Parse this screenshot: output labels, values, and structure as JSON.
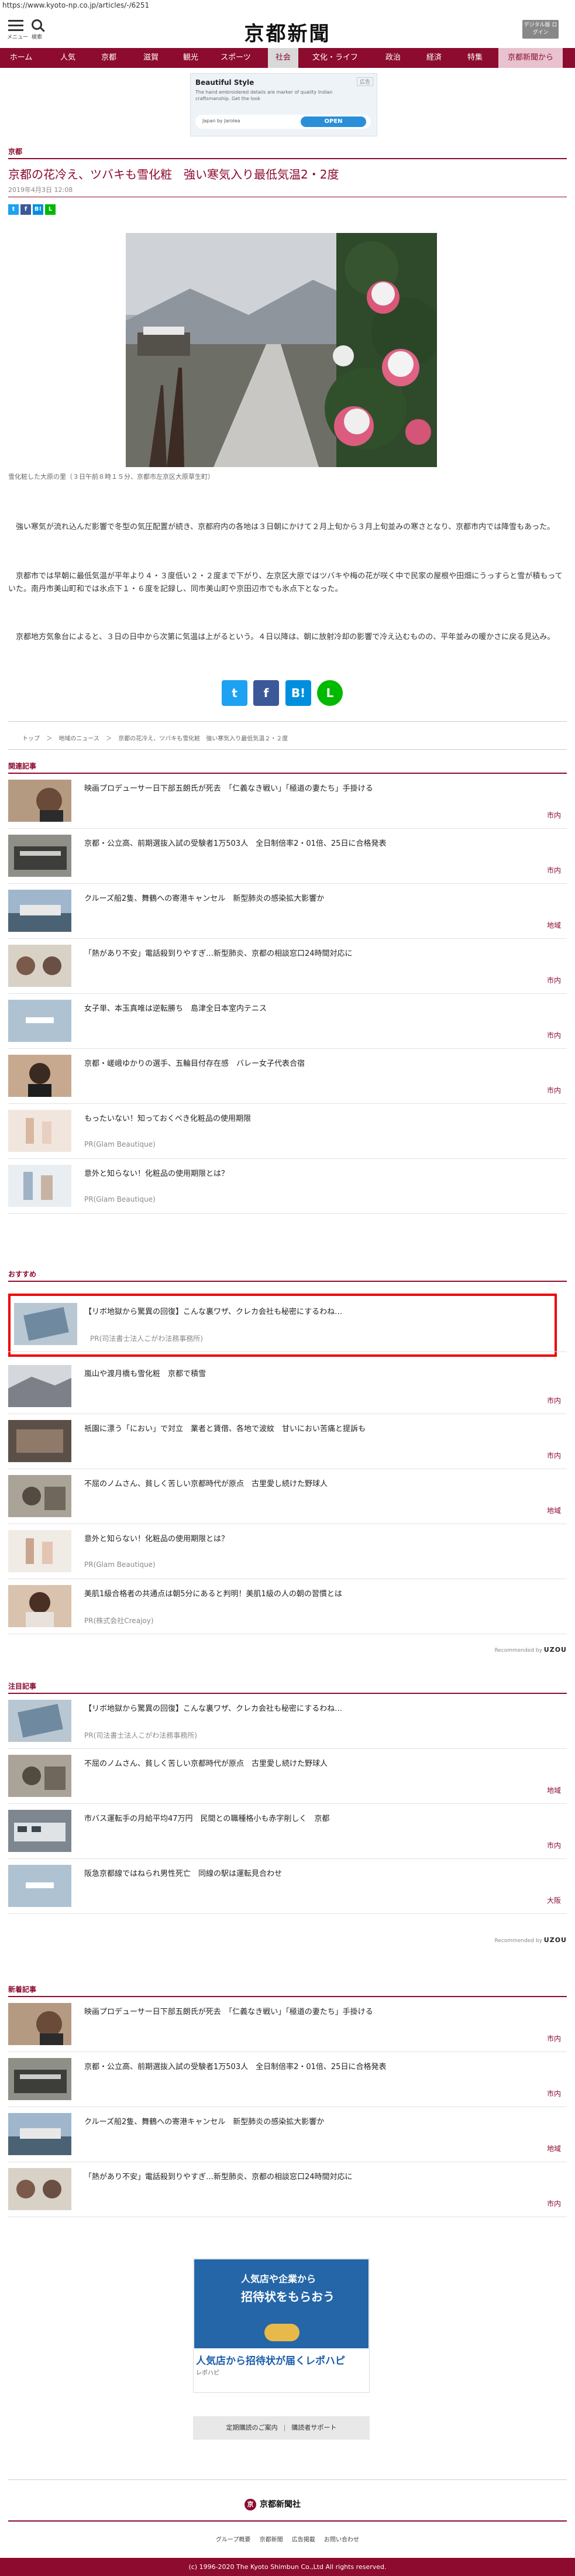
{
  "browser": {
    "url": "https://www.kyoto-np.co.jp/articles/-/6251"
  },
  "header": {
    "menu_label": "メニュー",
    "search_label": "検索",
    "logo": "京都新聞",
    "digital_button": "デジタル版 ログイン"
  },
  "nav": {
    "items": [
      "ホーム",
      "人気",
      "京都",
      "滋賀",
      "観光",
      "スポーツ",
      "社会",
      "文化・ライフ",
      "政治",
      "経済",
      "特集",
      "京都新聞から"
    ],
    "active": "社会"
  },
  "top_ad": {
    "mark": "広告",
    "title": "Beautiful Style",
    "description": "The hand embroidered details are marker of quality Indian craftsmanship. Get the look",
    "advertiser": "Japan by Jarolea",
    "cta": "OPEN"
  },
  "article": {
    "category": "京都",
    "title": "京都の花冷え、ツバキも雪化粧　強い寒気入り最低気温2・2度",
    "date": "2019年4月3日 12:08",
    "share_small": [
      "t",
      "f",
      "B!",
      "L"
    ],
    "photo_caption": "雪化粧した大原の里（３日午前８時１５分、京都市左京区大原草生町）",
    "paragraphs": [
      "　強い寒気が流れ込んだ影響で冬型の気圧配置が続き、京都府内の各地は３日朝にかけて２月上旬から３月上旬並みの寒さとなり、京都市内では降雪もあった。",
      "　京都市では早朝に最低気温が平年より４・３度低い２・２度まで下がり、左京区大原ではツバキや梅の花が咲く中で民家の屋根や田畑にうっすらと雪が積もっていた。南丹市美山町和では氷点下１・６度を記録し、同市美山町や京田辺市でも氷点下となった。",
      "　京都地方気象台によると、３日の日中から次第に気温は上がるという。４日以降は、朝に放射冷却の影響で冷え込むものの、平年並みの暖かさに戻る見込み。"
    ],
    "share_big": [
      "t",
      "f",
      "B!",
      "L"
    ],
    "breadcrumb": [
      "トップ",
      "＞",
      "地域のニュース",
      "＞",
      "京都の花冷え、ツバキも雪化粧　強い寒気入り最低気温２・２度"
    ]
  },
  "related": {
    "heading": "関連記事",
    "items": [
      {
        "title": "映画プロデューサー日下部五朗氏が死去　「仁義なき戦い」「極道の妻たち」手掛ける",
        "tag": "市内"
      },
      {
        "title": "京都・公立高、前期選抜入試の受験者1万503人　全日制倍率2・01倍、25日に合格発表",
        "tag": "市内"
      },
      {
        "title": "クルーズ船2隻、舞鶴への寄港キャンセル　新型肺炎の感染拡大影響か",
        "tag": "地域"
      },
      {
        "title": "「熱があり不安」電話殺到りやすぎ…新型肺炎、京都の相談窓口24時間対応に",
        "tag": "市内"
      },
      {
        "title": "女子単、本玉真唯は逆転勝ち　島津全日本室内テニス",
        "tag": "市内"
      },
      {
        "title": "京都・嵯峨ゆかりの選手、五輪目付存在感　バレー女子代表合宿",
        "tag": "市内"
      },
      {
        "title": "もったいない！知っておくべき化粧品の使用期限",
        "pr": "PR(Glam Beautique)"
      },
      {
        "title": "意外と知らない！化粧品の使用期限とは？",
        "pr": "PR(Glam Beautique)"
      }
    ]
  },
  "recommend": {
    "heading": "おすすめ",
    "items": [
      {
        "title": "【リボ地獄から驚異の回復】こんな裏ワザ、クレカ会社も秘密にするわね…",
        "pr": "PR(司法書士法人こがわ法務事務所)"
      },
      {
        "title": "嵐山や渡月橋も雪化粧　京都で積雪",
        "tag": "市内"
      },
      {
        "title": "祇園に漂う「におい」で対立　業者と賃借、各地で波紋　甘いにおい苦痛と提訴も",
        "tag": "市内"
      },
      {
        "title": "不屈のノムさん、貧しく苦しい京都時代が原点　古里愛し続けた野球人",
        "tag": "地域"
      },
      {
        "title": "意外と知らない！化粧品の使用期限とは？",
        "pr": "PR(Glam Beautique)"
      },
      {
        "title": "美肌1級合格者の共通点は朝5分にあると判明！美肌1級の人の朝の習慣とは",
        "pr": "PR(株式会社Creajoy)"
      }
    ],
    "recommended_by": "Recommended by",
    "recommended_brand": "UZOU"
  },
  "attention": {
    "heading": "注目記事",
    "items": [
      {
        "title": "【リボ地獄から驚異の回復】こんな裏ワザ、クレカ会社も秘密にするわね…",
        "pr": "PR(司法書士法人こがわ法務事務所)"
      },
      {
        "title": "不屈のノムさん、貧しく苦しい京都時代が原点　古里愛し続けた野球人",
        "tag": "地域"
      },
      {
        "title": "市バス運転手の月給平均47万円　民間との職種格小も赤字削しく　京都",
        "tag": "市内"
      },
      {
        "title": "阪急京都線ではねられ男性死亡　同線の駅は運転見合わせ",
        "tag": "大阪"
      }
    ],
    "recommended_by": "Recommended by",
    "recommended_brand": "UZOU"
  },
  "latest": {
    "heading": "新着記事",
    "items": [
      {
        "title": "映画プロデューサー日下部五朗氏が死去　「仁義なき戦い」「極道の妻たち」手掛ける",
        "tag": "市内"
      },
      {
        "title": "京都・公立高、前期選抜入試の受験者1万503人　全日制倍率2・01倍、25日に合格発表",
        "tag": "市内"
      },
      {
        "title": "クルーズ船2隻、舞鶴への寄港キャンセル　新型肺炎の感染拡大影響か",
        "tag": "地域"
      },
      {
        "title": "「熱があり不安」電話殺到りやすぎ…新型肺炎、京都の相談窓口24時間対応に",
        "tag": "市内"
      }
    ]
  },
  "bottom_ad": {
    "line1": "人気店や企業から",
    "line2": "招待状をもらおう",
    "line3": "",
    "headline": "人気店から招待状が届くレポハピ",
    "sub": "レポハピ"
  },
  "footer": {
    "links_left": "定期購読のご案内",
    "links_right": "購読者サポート",
    "links_sep": "|",
    "logo": "京都新聞社",
    "logo_mark": "京",
    "bottom_links": [
      "グループ概要",
      "京都新聞",
      "広告掲載",
      "お問い合わせ"
    ],
    "copyright": "(c) 1996-2020 The Kyoto Shimbun Co.,Ltd All rights reserved."
  },
  "colors": {
    "brand": "#8c0b2e",
    "tag": "#8c0b2e",
    "highlight": "#e00000"
  }
}
